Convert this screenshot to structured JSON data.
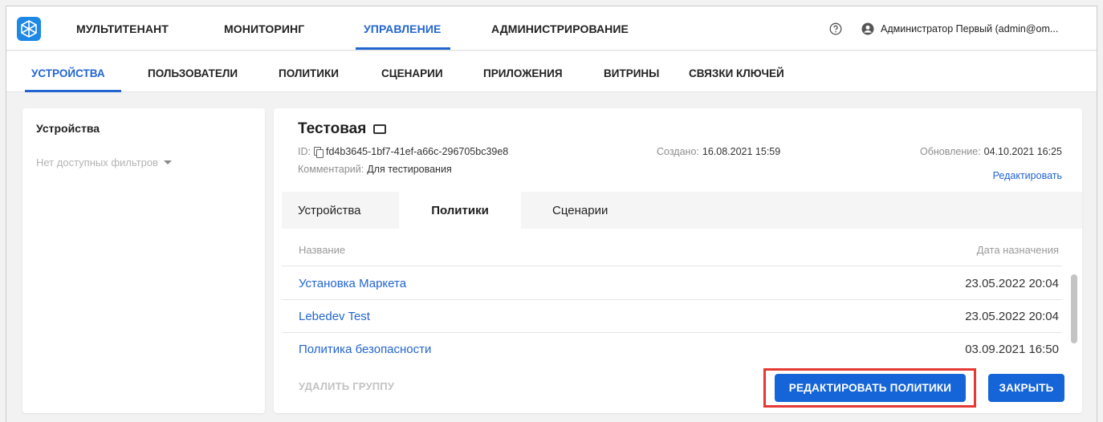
{
  "topnav": {
    "items": [
      "МУЛЬТИТЕНАНТ",
      "МОНИТОРИНГ",
      "УПРАВЛЕНИЕ",
      "АДМИНИСТРИРОВАНИЕ"
    ],
    "active": "УПРАВЛЕНИЕ"
  },
  "user": {
    "name": "Администратор Первый (admin@om..."
  },
  "subnav": {
    "items": [
      "УСТРОЙСТВА",
      "ПОЛЬЗОВАТЕЛИ",
      "ПОЛИТИКИ",
      "СЦЕНАРИИ",
      "ПРИЛОЖЕНИЯ",
      "ВИТРИНЫ",
      "СВЯЗКИ КЛЮЧЕЙ"
    ],
    "active": "УСТРОЙСТВА"
  },
  "left_panel": {
    "title": "Устройства",
    "filter_text": "Нет доступных фильтров"
  },
  "group": {
    "title": "Тестовая",
    "id_label": "ID:",
    "id_value": "fd4b3645-1bf7-41ef-a66c-296705bc39e8",
    "comment_label": "Комментарий:",
    "comment_value": "Для тестирования",
    "created_label": "Создано:",
    "created_value": "16.08.2021 15:59",
    "updated_label": "Обновление:",
    "updated_value": "04.10.2021 16:25",
    "edit_link": "Редактировать"
  },
  "tabs": {
    "items": [
      "Устройства",
      "Политики",
      "Сценарии"
    ],
    "active": "Политики"
  },
  "table": {
    "columns": [
      "Название",
      "Дата назначения"
    ],
    "rows": [
      {
        "name": "Установка Маркета",
        "date": "23.05.2022 20:04"
      },
      {
        "name": "Lebedev Test",
        "date": "23.05.2022 20:04"
      },
      {
        "name": "Политика безопасности",
        "date": "03.09.2021 16:50"
      }
    ]
  },
  "footer": {
    "delete_label": "УДАЛИТЬ ГРУППУ",
    "edit_policies_label": "РЕДАКТИРОВАТЬ ПОЛИТИКИ",
    "close_label": "ЗАКРЫТЬ"
  },
  "colors": {
    "accent": "#2265d0",
    "button": "#1565d8",
    "highlight": "#e53935"
  }
}
